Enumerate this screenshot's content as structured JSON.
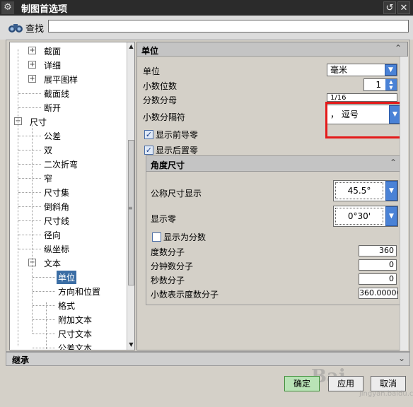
{
  "window": {
    "title": "制图首选项",
    "app_icon": "gear-icon"
  },
  "find": {
    "label": "查找",
    "value": ""
  },
  "tree": [
    {
      "label": "截面",
      "level": 1,
      "expander": "+"
    },
    {
      "label": "详细",
      "level": 1,
      "expander": "+"
    },
    {
      "label": "展平图样",
      "level": 1,
      "expander": "+"
    },
    {
      "label": "截面线",
      "level": 1,
      "expander": ""
    },
    {
      "label": "断开",
      "level": 1,
      "expander": ""
    },
    {
      "label": "尺寸",
      "level": 0,
      "expander": "−"
    },
    {
      "label": "公差",
      "level": 1,
      "expander": ""
    },
    {
      "label": "双",
      "level": 1,
      "expander": ""
    },
    {
      "label": "二次折弯",
      "level": 1,
      "expander": ""
    },
    {
      "label": "窄",
      "level": 1,
      "expander": ""
    },
    {
      "label": "尺寸集",
      "level": 1,
      "expander": ""
    },
    {
      "label": "倒斜角",
      "level": 1,
      "expander": ""
    },
    {
      "label": "尺寸线",
      "level": 1,
      "expander": ""
    },
    {
      "label": "径向",
      "level": 1,
      "expander": ""
    },
    {
      "label": "纵坐标",
      "level": 1,
      "expander": ""
    },
    {
      "label": "文本",
      "level": 1,
      "expander": "−"
    },
    {
      "label": "单位",
      "level": 2,
      "expander": "",
      "selected": true
    },
    {
      "label": "方向和位置",
      "level": 2,
      "expander": ""
    },
    {
      "label": "格式",
      "level": 2,
      "expander": ""
    },
    {
      "label": "附加文本",
      "level": 2,
      "expander": ""
    },
    {
      "label": "尺寸文本",
      "level": 2,
      "expander": ""
    },
    {
      "label": "公差文本",
      "level": 2,
      "expander": ""
    }
  ],
  "units_section": {
    "title": "单位",
    "unit_label": "单位",
    "unit_value": "毫米",
    "decimals_label": "小数位数",
    "decimals_value": "1",
    "fraction_label": "分数分母",
    "fraction_value": "1/16",
    "separator_label": "小数分隔符",
    "separator_value": "，  逗号",
    "show_leading_zeros": "显示前导零",
    "show_trailing_zeros": "显示后置零"
  },
  "angle_section": {
    "title": "角度尺寸",
    "nominal_label": "公称尺寸显示",
    "nominal_value": "45.5°",
    "zero_label": "显示零",
    "zero_value": "0°30'",
    "as_fraction": "显示为分数",
    "deg_num_label": "度数分子",
    "deg_num_value": "360",
    "min_num_label": "分钟数分子",
    "min_num_value": "0",
    "sec_num_label": "秒数分子",
    "sec_num_value": "0",
    "dec_num_label": "小数表示度数分子",
    "dec_num_value": "360.00000"
  },
  "inherit": {
    "label": "继承"
  },
  "buttons": {
    "ok": "确定",
    "apply": "应用",
    "cancel": "取消"
  },
  "watermark": {
    "logo": "Bai",
    "site": "jingyan.baidu.com"
  },
  "colors": {
    "selected": "#3b6ea5",
    "highlight": "#e41a1a",
    "dropdown": "#4a82d6",
    "ok_button": "#b9e3b6"
  }
}
